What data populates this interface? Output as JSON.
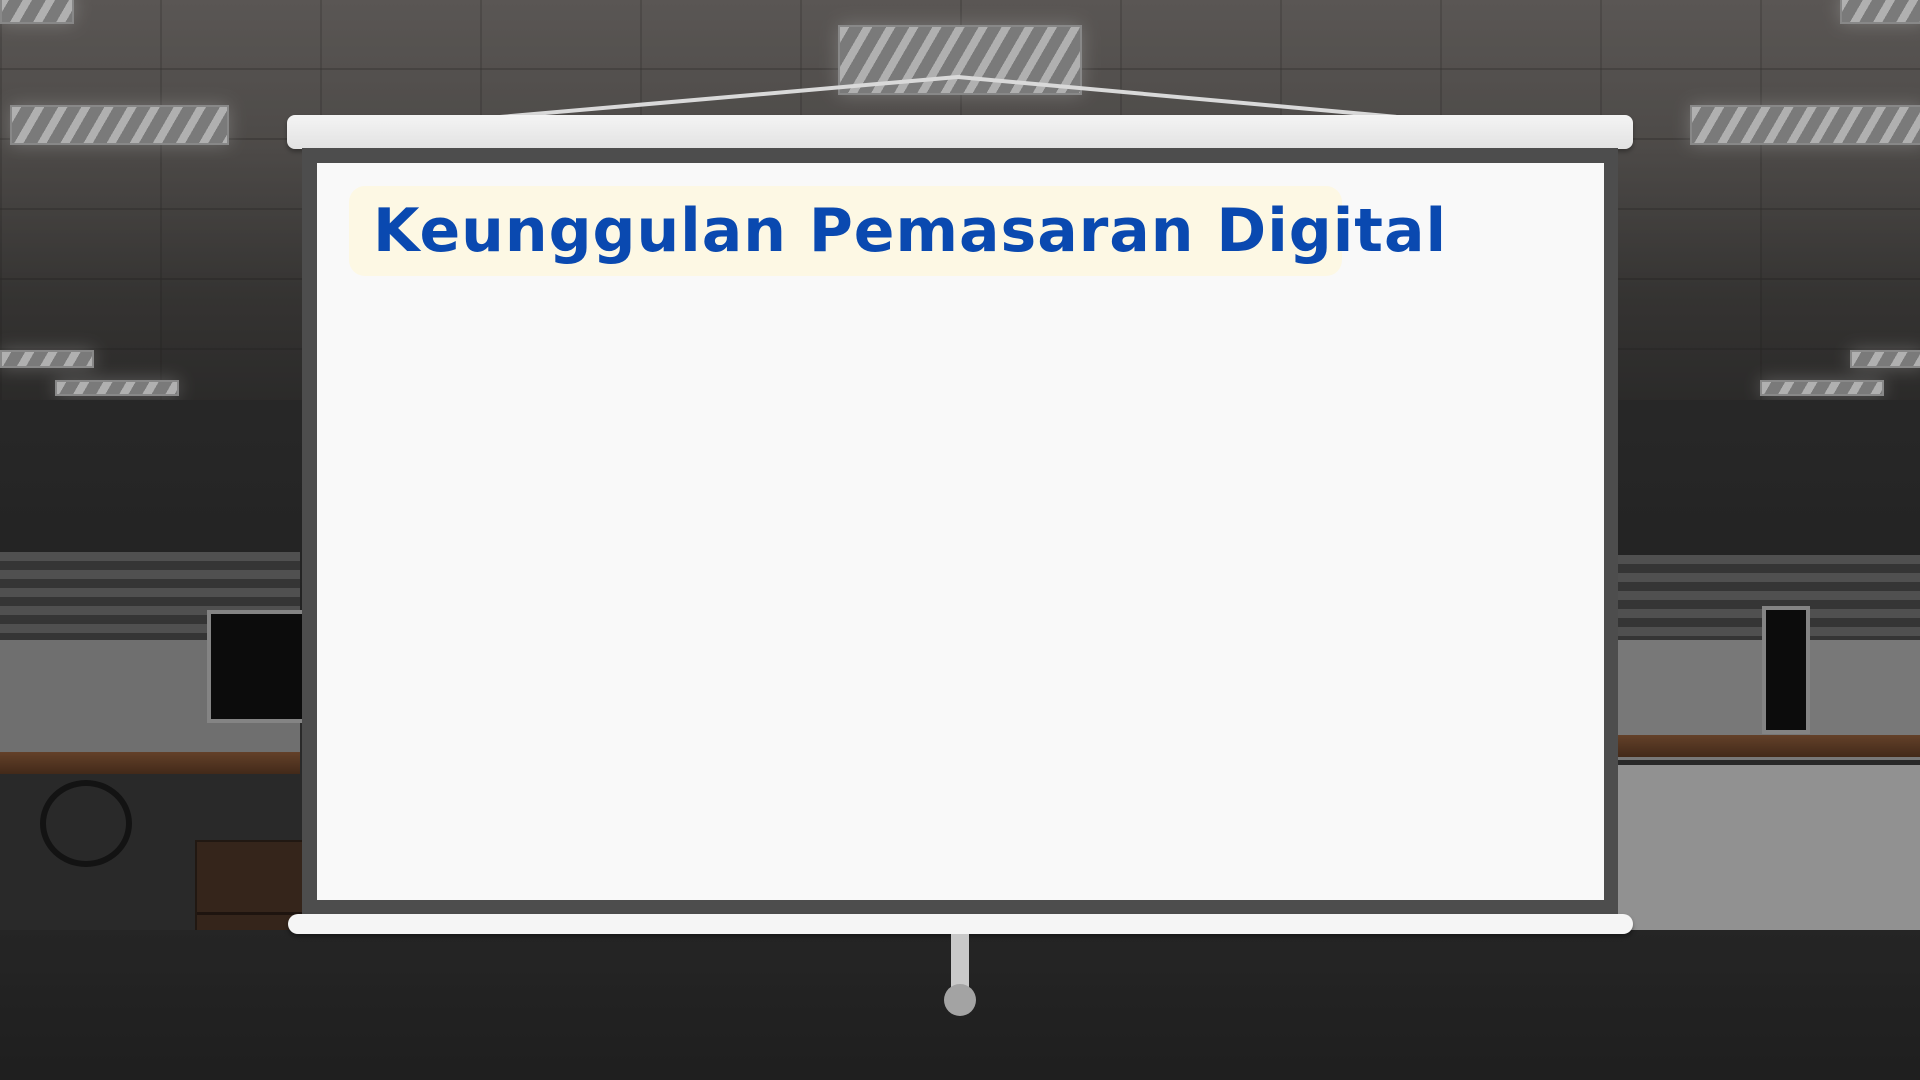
{
  "slide": {
    "title": "Keunggulan Pemasaran Digital"
  },
  "colors": {
    "title_text": "#0a49b0",
    "title_background": "#fdf8e4",
    "screen": "#f9f9f9",
    "screen_frame": "#4d4d4d"
  },
  "background": {
    "scene": "office-interior"
  }
}
